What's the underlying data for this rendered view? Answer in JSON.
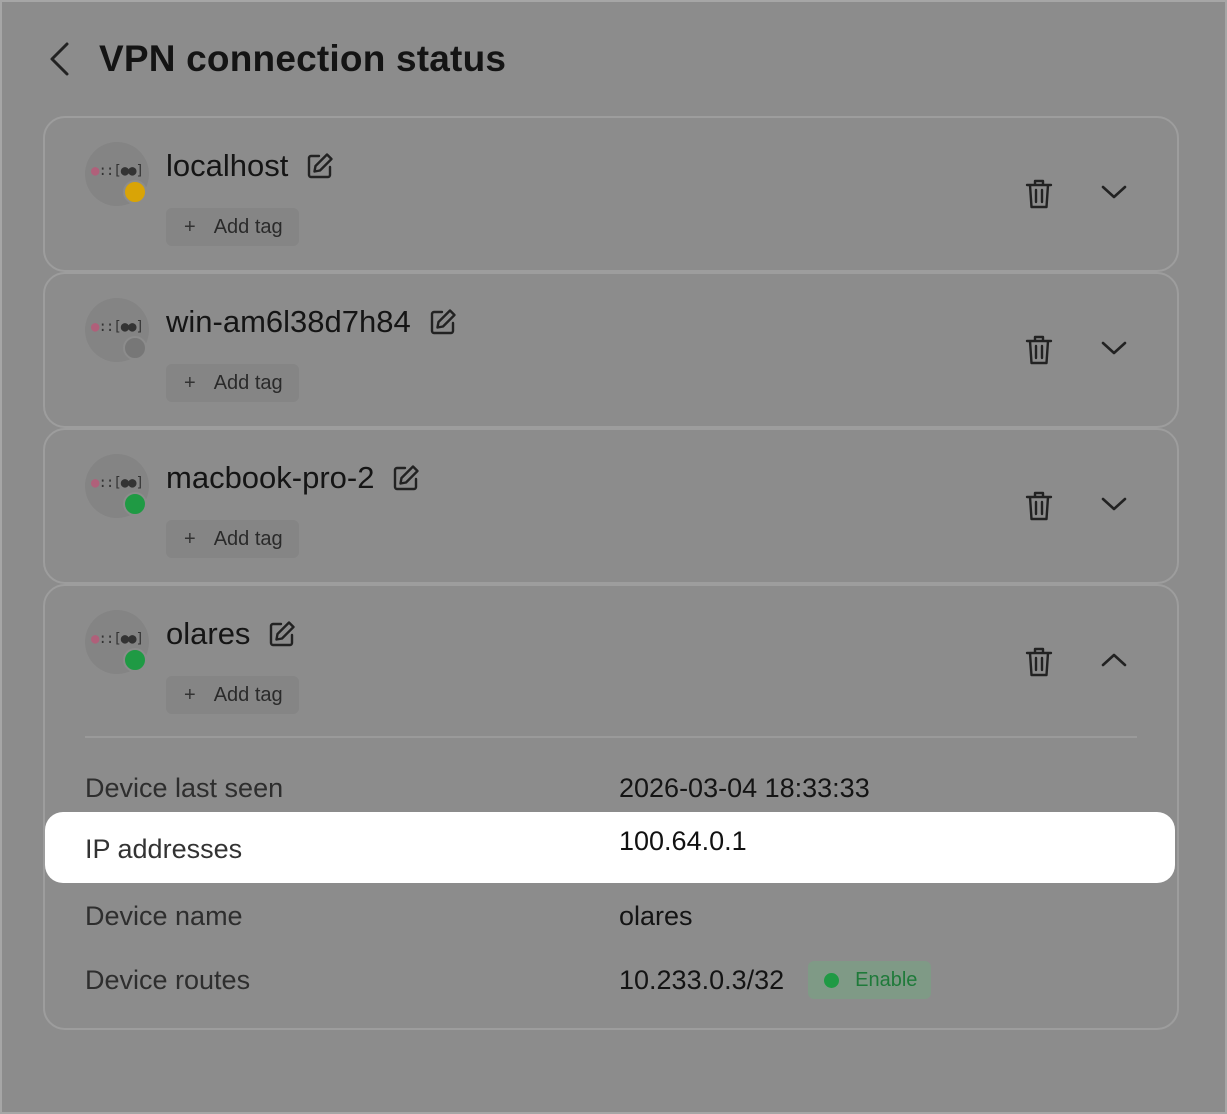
{
  "header": {
    "title": "VPN connection status"
  },
  "colors": {
    "status_yellow": "#d9a406",
    "status_gray": "#777777",
    "status_green": "#1f9a44"
  },
  "devices": [
    {
      "name": "localhost",
      "add_tag_label": "Add tag",
      "status_color": "#d9a406",
      "expanded": false
    },
    {
      "name": "win-am6l38d7h84",
      "add_tag_label": "Add tag",
      "status_color": "#777777",
      "expanded": false
    },
    {
      "name": "macbook-pro-2",
      "add_tag_label": "Add tag",
      "status_color": "#1f9a44",
      "expanded": false
    },
    {
      "name": "olares",
      "add_tag_label": "Add tag",
      "status_color": "#1f9a44",
      "expanded": true
    }
  ],
  "details": {
    "last_seen": {
      "label": "Device last seen",
      "value": "2026-03-04 18:33:33"
    },
    "ip_addresses": {
      "label": "IP addresses",
      "value": "100.64.0.1"
    },
    "device_name": {
      "label": "Device name",
      "value": "olares"
    },
    "routes": {
      "label": "Device routes",
      "value": "10.233.0.3/32",
      "badge": "Enable"
    }
  },
  "icons": {
    "back": "chevron-left-icon",
    "edit": "edit-icon",
    "delete": "trash-icon",
    "expand": "chevron-down-icon",
    "collapse": "chevron-up-icon",
    "add": "plus-icon"
  }
}
